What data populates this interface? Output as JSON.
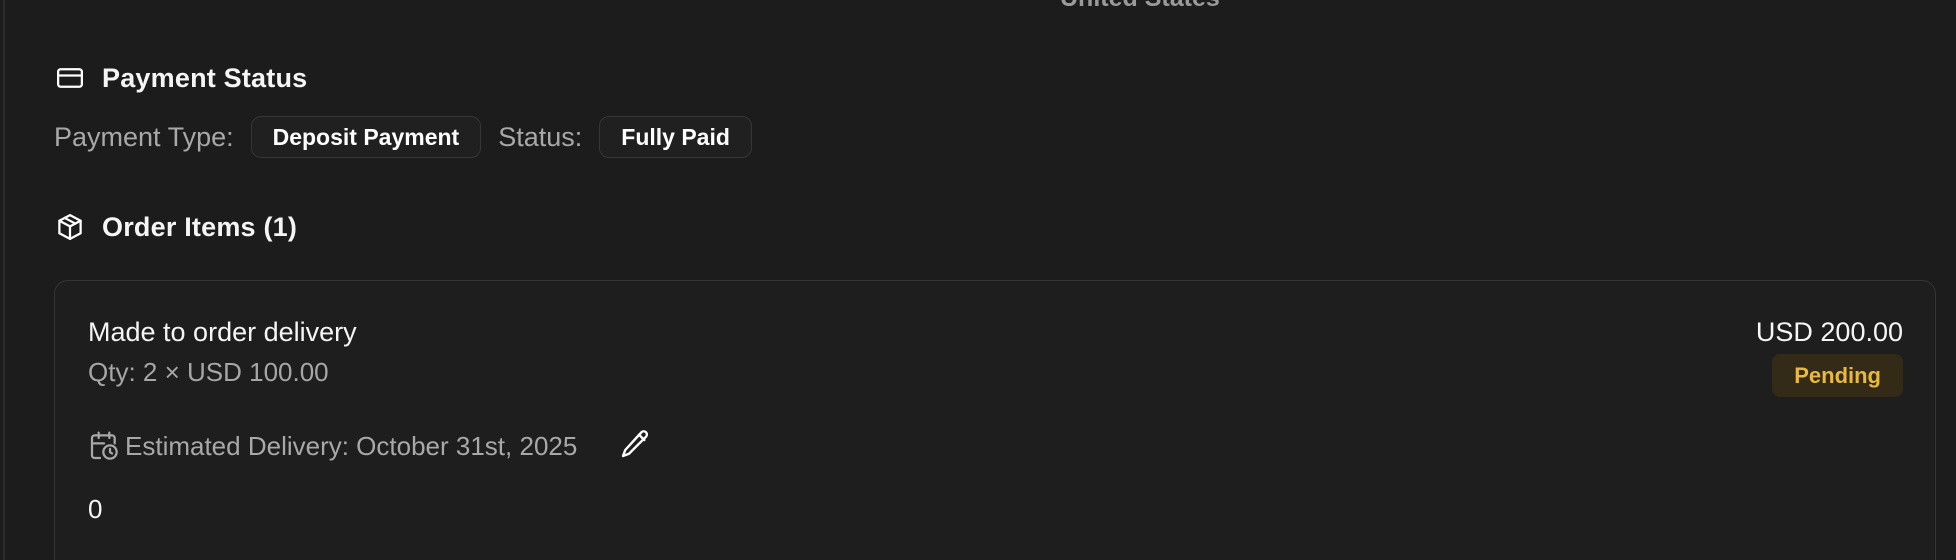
{
  "top_fragment": "United States",
  "payment": {
    "title": "Payment Status",
    "type_label": "Payment Type:",
    "type_value": "Deposit Payment",
    "status_label": "Status:",
    "status_value": "Fully Paid"
  },
  "items": {
    "title": "Order Items (1)",
    "list": [
      {
        "name": "Made to order delivery",
        "qty_text": "Qty: 2 × USD 100.00",
        "total": "USD 200.00",
        "badge": "Pending",
        "delivery_text": "Estimated Delivery: October 31st, 2025",
        "extra": "0"
      }
    ]
  },
  "icons": {
    "payment": "credit-card-icon",
    "items": "package-icon",
    "delivery": "calendar-clock-icon",
    "edit": "pencil-icon"
  },
  "colors": {
    "background": "#1c1c1c",
    "pending_text": "#e9b93c",
    "pending_bg": "#332a17"
  }
}
